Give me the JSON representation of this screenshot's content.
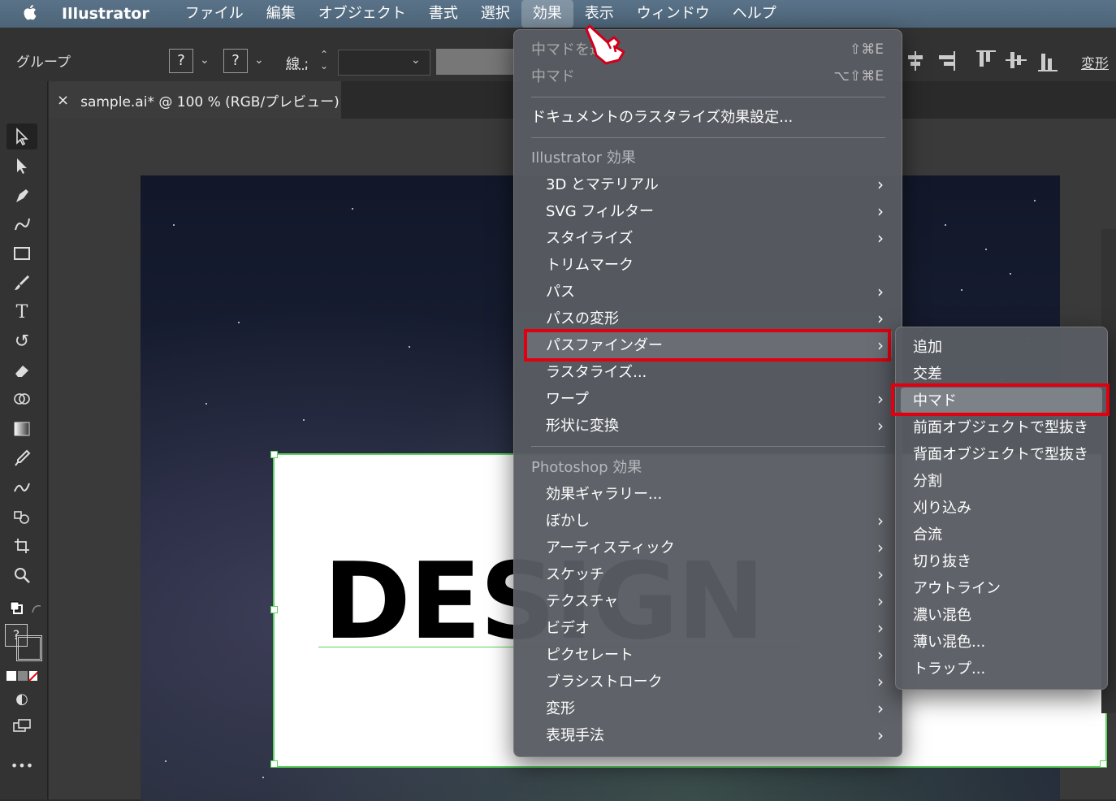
{
  "menubar": {
    "app_name": "Illustrator",
    "items": [
      "ファイル",
      "編集",
      "オブジェクト",
      "書式",
      "選択",
      "効果",
      "表示",
      "ウィンドウ",
      "ヘルプ"
    ],
    "active_index": 5
  },
  "controlbar": {
    "selection_label": "グループ",
    "fill_value": "?",
    "stroke_value": "?",
    "stroke_label": "線 :",
    "transform_label": "変形"
  },
  "document_tab": {
    "close": "×",
    "title": "sample.ai* @ 100 % (RGB/プレビュー)"
  },
  "artwork": {
    "text": "DESIGN"
  },
  "toolbar": {
    "more": "•••",
    "fill_stroke_value": "?"
  },
  "effect_menu": {
    "apply_last": {
      "label": "中マドを適用",
      "shortcut": "⇧⌘E"
    },
    "last_effect": {
      "label": "中マド",
      "shortcut": "⌥⇧⌘E"
    },
    "raster_settings": "ドキュメントのラスタライズ効果設定...",
    "illustrator_header": "Illustrator 効果",
    "illustrator_items": [
      {
        "label": "3D とマテリアル",
        "submenu": true
      },
      {
        "label": "SVG フィルター",
        "submenu": true
      },
      {
        "label": "スタイライズ",
        "submenu": true
      },
      {
        "label": "トリムマーク",
        "submenu": false
      },
      {
        "label": "パス",
        "submenu": true
      },
      {
        "label": "パスの変形",
        "submenu": true
      },
      {
        "label": "パスファインダー",
        "submenu": true
      },
      {
        "label": "ラスタライズ...",
        "submenu": false
      },
      {
        "label": "ワープ",
        "submenu": true
      },
      {
        "label": "形状に変換",
        "submenu": true
      }
    ],
    "photoshop_header": "Photoshop 効果",
    "photoshop_items": [
      {
        "label": "効果ギャラリー...",
        "submenu": false
      },
      {
        "label": "ぼかし",
        "submenu": true
      },
      {
        "label": "アーティスティック",
        "submenu": true
      },
      {
        "label": "スケッチ",
        "submenu": true
      },
      {
        "label": "テクスチャ",
        "submenu": true
      },
      {
        "label": "ビデオ",
        "submenu": true
      },
      {
        "label": "ピクセレート",
        "submenu": true
      },
      {
        "label": "ブラシストローク",
        "submenu": true
      },
      {
        "label": "変形",
        "submenu": true
      },
      {
        "label": "表現手法",
        "submenu": true
      }
    ],
    "arrow": "›"
  },
  "pathfinder_submenu": {
    "items": [
      "追加",
      "交差",
      "中マド",
      "前面オブジェクトで型抜き",
      "背面オブジェクトで型抜き",
      "分割",
      "刈り込み",
      "合流",
      "切り抜き",
      "アウトライン",
      "濃い混色",
      "薄い混色...",
      "トラップ..."
    ],
    "highlighted_index": 2
  },
  "colors": {
    "highlight_box": "#e0000f",
    "selection_green": "#5dd45d",
    "menubar": "#4d6478"
  }
}
